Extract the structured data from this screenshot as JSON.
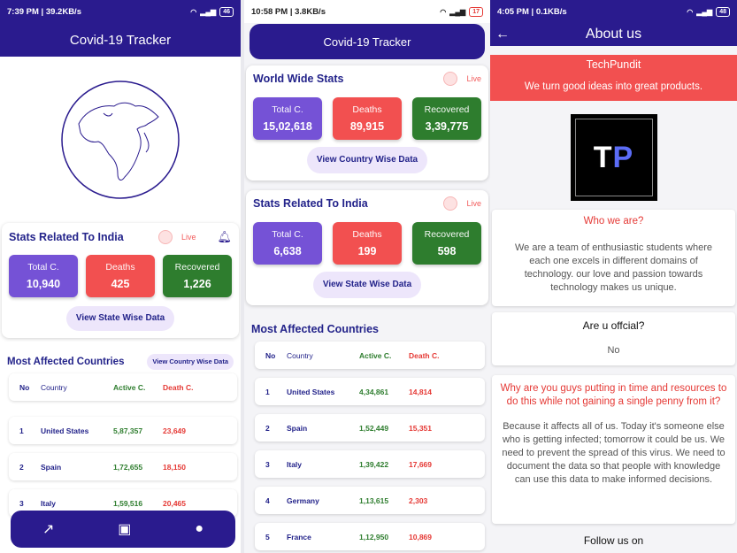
{
  "colors": {
    "primary": "#2a1b8e",
    "total": "#7552d6",
    "deaths": "#f25050",
    "recovered": "#2e7d2e",
    "accent_red": "#e53935"
  },
  "panel1": {
    "status": {
      "time": "7:39 PM | 39.2KB/s",
      "battery": "46"
    },
    "app_title": "Covid-19 Tracker",
    "india": {
      "title": "Stats Related To India",
      "live": "Live",
      "total_label": "Total C.",
      "total": "10,940",
      "deaths_label": "Deaths",
      "deaths": "425",
      "recovered_label": "Recovered",
      "recovered": "1,226",
      "button": "View State Wise Data"
    },
    "most_affected": {
      "title": "Most Affected Countries",
      "button": "View Country Wise Data",
      "headers": [
        "No",
        "Country",
        "Active C.",
        "Death C."
      ],
      "rows": [
        [
          "1",
          "United States",
          "5,87,357",
          "23,649"
        ],
        [
          "2",
          "Spain",
          "1,72,655",
          "18,150"
        ],
        [
          "3",
          "Italy",
          "1,59,516",
          "20,465"
        ]
      ]
    },
    "nav_icons": [
      "trending-up-icon",
      "contact-card-icon",
      "person-icon"
    ]
  },
  "panel2": {
    "status": {
      "time": "10:58 PM | 3.8KB/s",
      "battery": "17"
    },
    "app_title": "Covid-19 Tracker",
    "world": {
      "title": "World Wide Stats",
      "live": "Live",
      "total_label": "Total C.",
      "total": "15,02,618",
      "deaths_label": "Deaths",
      "deaths": "89,915",
      "recovered_label": "Recovered",
      "recovered": "3,39,775",
      "button": "View Country Wise Data"
    },
    "india": {
      "title": "Stats Related To India",
      "live": "Live",
      "total_label": "Total C.",
      "total": "6,638",
      "deaths_label": "Deaths",
      "deaths": "199",
      "recovered_label": "Recovered",
      "recovered": "598",
      "button": "View State Wise Data"
    },
    "most_affected": {
      "title": "Most Affected Countries",
      "headers": [
        "No",
        "Country",
        "Active C.",
        "Death C."
      ],
      "rows": [
        [
          "1",
          "United States",
          "4,34,861",
          "14,814"
        ],
        [
          "2",
          "Spain",
          "1,52,449",
          "15,351"
        ],
        [
          "3",
          "Italy",
          "1,39,422",
          "17,669"
        ],
        [
          "4",
          "Germany",
          "1,13,615",
          "2,303"
        ],
        [
          "5",
          "France",
          "1,12,950",
          "10,869"
        ]
      ]
    }
  },
  "panel3": {
    "status": {
      "time": "4:05 PM | 0.1KB/s",
      "battery": "48"
    },
    "title": "About us",
    "banner_title": "TechPundit",
    "banner_subtitle": "We turn good ideas into great products.",
    "logo_text": {
      "t": "T",
      "p": "P"
    },
    "q1": "Who we are?",
    "a1": "We are a team of enthusiastic students where each one excels in different domains of technology. our love and passion towards technology makes us unique.",
    "q2": "Are u offcial?",
    "a2": "No",
    "q3": "Why are you guys putting in time and resources to do this while not gaining a single penny from it?",
    "a3": "Because it affects all of us. Today it's someone else who is getting infected; tomorrow it could be us. We need to prevent the spread of this virus. We need to document the data so that people with knowledge can use this data to make informed decisions.",
    "follow": "Follow us on"
  }
}
